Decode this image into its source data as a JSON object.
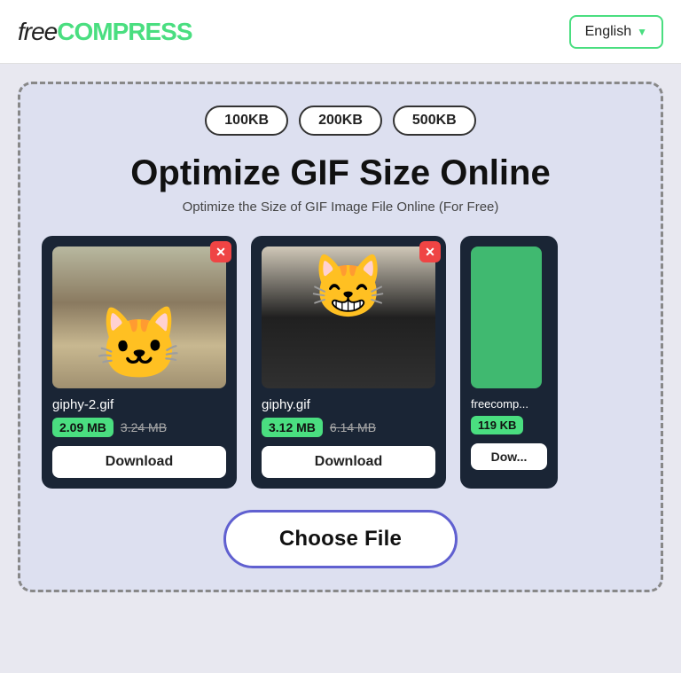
{
  "header": {
    "logo_free": "free",
    "logo_compress": "COMPRESS",
    "lang_label": "English",
    "lang_chevron": "▼"
  },
  "main": {
    "presets": [
      {
        "label": "100KB"
      },
      {
        "label": "200KB"
      },
      {
        "label": "500KB"
      }
    ],
    "title": "Optimize GIF Size Online",
    "subtitle": "Optimize the Size of GIF Image File Online (For Free)",
    "cards": [
      {
        "filename": "giphy-2.gif",
        "size_new": "2.09 MB",
        "size_old": "3.24 MB",
        "download_label": "Download"
      },
      {
        "filename": "giphy.gif",
        "size_new": "3.12 MB",
        "size_old": "6.14 MB",
        "download_label": "Download"
      },
      {
        "filename": "freecomp...",
        "size_new": "119 KB",
        "size_old": "",
        "download_label": "Dow..."
      }
    ],
    "choose_file_label": "Choose File"
  }
}
